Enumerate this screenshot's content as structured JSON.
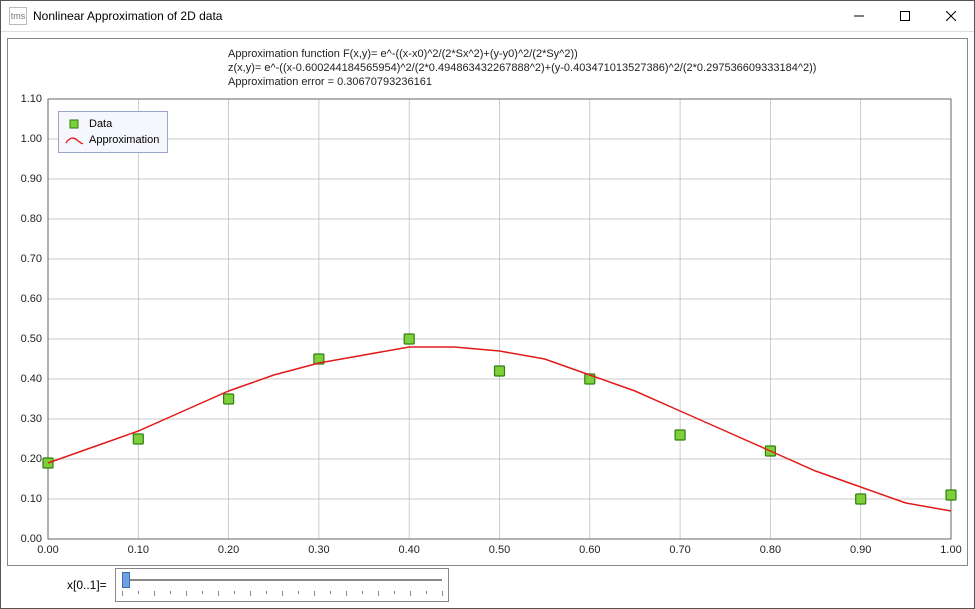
{
  "window": {
    "title": "Nonlinear Approximation of 2D data",
    "icon_label": "tms"
  },
  "annotations": {
    "line1": "Approximation function F(x,y)= e^-((x-x0)^2/(2*Sx^2)+(y-y0)^2/(2*Sy^2))",
    "line2": "z(x,y)= e^-((x-0.600244184565954)^2/(2*0.494863432267888^2)+(y-0.403471013527386)^2/(2*0.297536609333184^2))",
    "line3": "Approximation error = 0.30670793236161"
  },
  "legend": {
    "data_label": "Data",
    "approx_label": "Approximation"
  },
  "slider": {
    "label": "x[0..1]=",
    "min": 0,
    "max": 1,
    "step": 0.01,
    "value": 0
  },
  "axes": {
    "x_ticks": [
      "0.00",
      "0.10",
      "0.20",
      "0.30",
      "0.40",
      "0.50",
      "0.60",
      "0.70",
      "0.80",
      "0.90",
      "1.00"
    ],
    "y_ticks": [
      "0.00",
      "0.10",
      "0.20",
      "0.30",
      "0.40",
      "0.50",
      "0.60",
      "0.70",
      "0.80",
      "0.90",
      "1.00",
      "1.10"
    ]
  },
  "chart_data": {
    "type": "scatter",
    "title": "",
    "xlabel": "",
    "ylabel": "",
    "xlim": [
      0.0,
      1.0
    ],
    "ylim": [
      0.0,
      1.1
    ],
    "series": [
      {
        "name": "Data",
        "style": "points",
        "color": "#3aa41f",
        "x": [
          0.0,
          0.1,
          0.2,
          0.3,
          0.4,
          0.5,
          0.6,
          0.7,
          0.8,
          0.9,
          1.0
        ],
        "y": [
          0.19,
          0.25,
          0.35,
          0.45,
          0.5,
          0.42,
          0.4,
          0.26,
          0.22,
          0.1,
          0.11
        ]
      },
      {
        "name": "Approximation",
        "style": "line",
        "color": "#e21a1a",
        "x": [
          0.0,
          0.05,
          0.1,
          0.15,
          0.2,
          0.25,
          0.3,
          0.35,
          0.4,
          0.45,
          0.5,
          0.55,
          0.6,
          0.65,
          0.7,
          0.75,
          0.8,
          0.85,
          0.9,
          0.95,
          1.0
        ],
        "y": [
          0.19,
          0.23,
          0.27,
          0.32,
          0.37,
          0.41,
          0.44,
          0.46,
          0.48,
          0.48,
          0.47,
          0.45,
          0.41,
          0.37,
          0.32,
          0.27,
          0.22,
          0.17,
          0.13,
          0.09,
          0.07
        ]
      }
    ]
  },
  "colors": {
    "grid": "#b8b8b8",
    "axis": "#666",
    "point_fill": "#7fcf3a",
    "point_stroke": "#2f7f12",
    "line": "#e21a1a",
    "legend_border": "#9aa5c7",
    "legend_bg": "#f5f7fc"
  }
}
